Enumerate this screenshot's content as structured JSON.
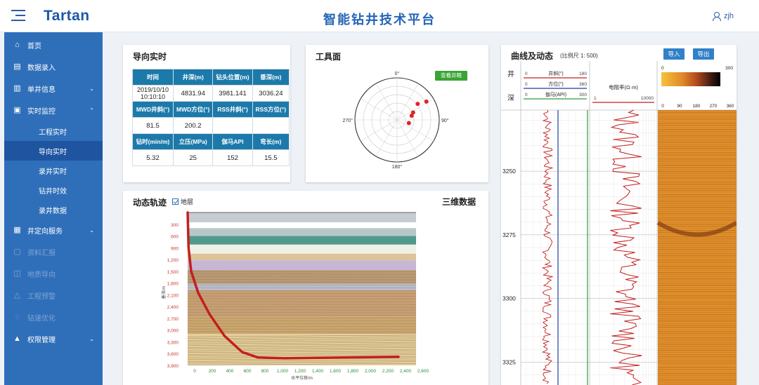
{
  "header": {
    "logo": "Tartan",
    "title": "智能钻井技术平台",
    "user": "zjh"
  },
  "sidebar": {
    "items": [
      {
        "label": "首页",
        "icon": "home-icon"
      },
      {
        "label": "数据录入",
        "icon": "data-entry-icon"
      },
      {
        "label": "单井信息",
        "icon": "well-info-icon"
      },
      {
        "label": "实时监控",
        "icon": "monitor-icon"
      },
      {
        "label": "井定向服务",
        "icon": "directional-icon"
      },
      {
        "label": "资料汇报",
        "icon": "report-icon"
      },
      {
        "label": "地质导向",
        "icon": "geosteering-icon"
      },
      {
        "label": "工程预警",
        "icon": "warning-icon"
      },
      {
        "label": "钻速优化",
        "icon": "optimize-icon"
      },
      {
        "label": "权限管理",
        "icon": "permission-icon"
      }
    ],
    "subitems": [
      "工程实时",
      "导向实时",
      "录井实时",
      "钻井时效",
      "录井数据"
    ]
  },
  "guide": {
    "title": "导向实时",
    "headers1": [
      "时间",
      "井深(m)",
      "钻头位置(m)",
      "垂深(m)"
    ],
    "values1": [
      "2019/10/10 10:10:10",
      "4831.94",
      "3981.141",
      "3036.24"
    ],
    "headers2": [
      "MWD井斜(°)",
      "MWD方位(°)",
      "RSS井斜(°)",
      "RSS方位(°)"
    ],
    "values2": [
      "81.5",
      "200.2",
      "",
      ""
    ],
    "headers3": [
      "钻时(min/m)",
      "立压(MPa)",
      "伽马API",
      "弯长(m)"
    ],
    "values3": [
      "5.32",
      "25",
      "152",
      "15.5"
    ]
  },
  "toolface": {
    "title": "工具面",
    "button": "查看井眼",
    "angle_labels": [
      "0°",
      "90°",
      "180°",
      "270°"
    ],
    "points": [
      {
        "angle": 52,
        "r": 0.62
      },
      {
        "angle": 58,
        "r": 0.82
      },
      {
        "angle": 65,
        "r": 0.42
      },
      {
        "angle": 74,
        "r": 0.36
      },
      {
        "angle": 105,
        "r": 0.29
      }
    ]
  },
  "trajectory": {
    "title": "动态轨迹",
    "checkbox_label": "地层",
    "right_title": "三维数据",
    "y_axis_label": "垂深/m",
    "x_axis_label": "水平位移/m",
    "y_ticks": [
      "300",
      "600",
      "900",
      "1,200",
      "1,500",
      "1,800",
      "2,100",
      "2,400",
      "2,700",
      "3,000",
      "3,300",
      "3,600",
      "3,900"
    ],
    "x_ticks": [
      "0",
      "200",
      "400",
      "600",
      "800",
      "1,000",
      "1,200",
      "1,400",
      "1,600",
      "1,800",
      "2,000",
      "2,200",
      "2,400",
      "2,600"
    ],
    "path": [
      [
        0,
        0
      ],
      [
        10,
        900
      ],
      [
        40,
        1500
      ],
      [
        120,
        2050
      ],
      [
        250,
        2600
      ],
      [
        420,
        3150
      ],
      [
        620,
        3560
      ],
      [
        800,
        3700
      ],
      [
        1100,
        3720
      ],
      [
        2400,
        3680
      ]
    ],
    "color": "#c41f1f"
  },
  "curves": {
    "title": "曲线及动态",
    "scale": "(比例尺 1:  500)",
    "import_btn": "导入",
    "export_btn": "导出",
    "depth_header": [
      "井",
      "深"
    ],
    "legends": [
      {
        "name": "井斜(°)",
        "min": "0",
        "max": "180",
        "color": "#c41f1f"
      },
      {
        "name": "方位(°)",
        "min": "0",
        "max": "360",
        "color": "#1f3f9e"
      },
      {
        "name": "伽马(API)",
        "min": "0",
        "max": "300",
        "color": "#2e9a3a"
      }
    ],
    "resistivity": {
      "name": "电阻率(Ω·m)",
      "min": "1",
      "max": "10000",
      "color": "#c41f1f"
    },
    "image": {
      "min": "0",
      "max": "300",
      "ticks": [
        "0",
        "90",
        "180",
        "270",
        "360"
      ]
    },
    "depth_ticks": [
      "3250",
      "3275",
      "3300",
      "3325"
    ]
  }
}
